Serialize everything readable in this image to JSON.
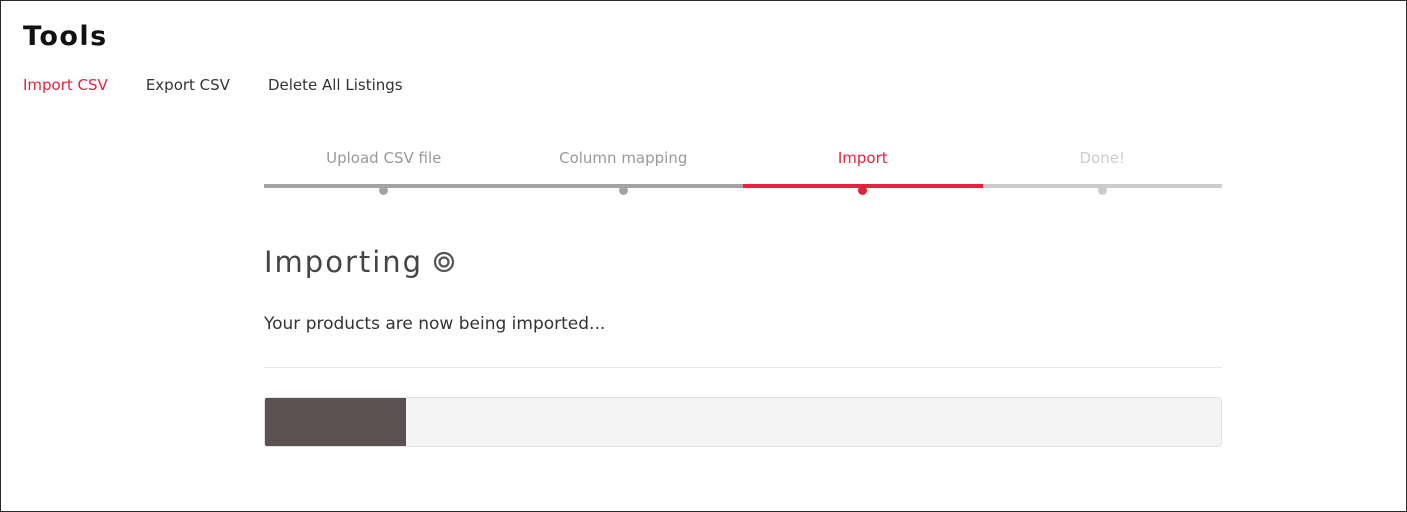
{
  "page": {
    "title": "Tools"
  },
  "tool_tabs": [
    {
      "label": "Import CSV",
      "active": true
    },
    {
      "label": "Export CSV",
      "active": false
    },
    {
      "label": "Delete All Listings",
      "active": false
    }
  ],
  "wizard": {
    "steps": [
      {
        "label": "Upload CSV file",
        "state": "completed"
      },
      {
        "label": "Column mapping",
        "state": "completed"
      },
      {
        "label": "Import",
        "state": "current"
      },
      {
        "label": "Done!",
        "state": "upcoming"
      }
    ]
  },
  "import_status": {
    "heading": "Importing",
    "spinner_icon": "spinner-icon",
    "message": "Your products are now being imported...",
    "progress_fraction": 0.148
  },
  "colors": {
    "accent": "#e8213d",
    "progress_fill": "#5a5150",
    "step_completed": "#a3a3a3",
    "step_upcoming": "#cccccc"
  }
}
